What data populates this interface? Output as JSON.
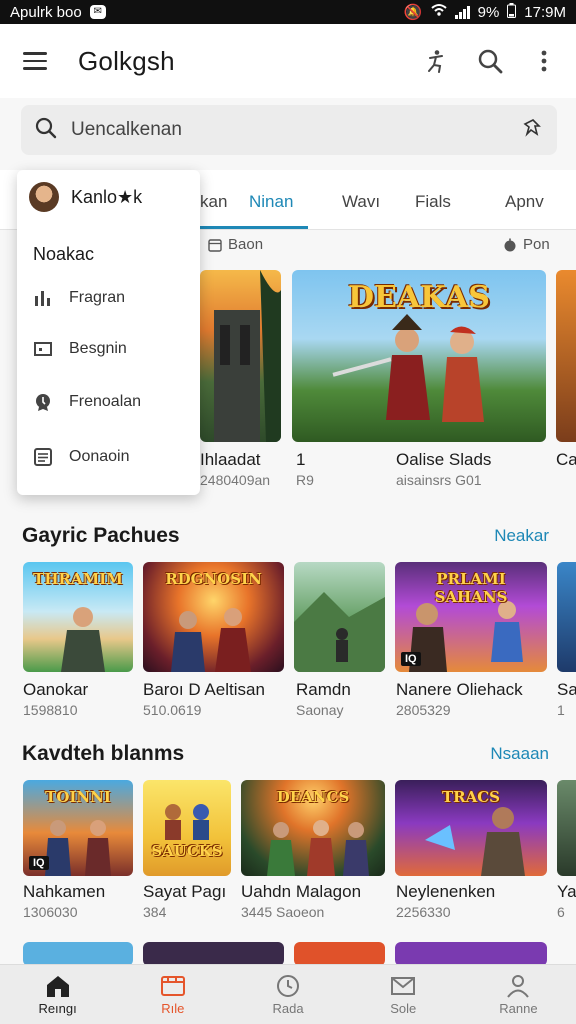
{
  "status_bar": {
    "carrier": "Apulrk boo",
    "battery": "9%",
    "time": "17:9M"
  },
  "app_bar": {
    "title": "Golkgsh",
    "icons": [
      "menu-icon",
      "accessibility-icon",
      "search-icon",
      "more-vert-icon"
    ]
  },
  "search": {
    "placeholder": "Uencalkenan"
  },
  "tabs": [
    {
      "label": "kan"
    },
    {
      "label": "Ninan",
      "active": true
    },
    {
      "label": "Wavı"
    },
    {
      "label": "Fials"
    },
    {
      "label": "Apnv"
    }
  ],
  "filters": {
    "left": "Baon",
    "right": "Pon"
  },
  "dropdown": {
    "user_name": "Kanlo★k",
    "section": "Noakac",
    "items": [
      {
        "label": "Fragran",
        "icon": "chart-icon"
      },
      {
        "label": "Besgnin",
        "icon": "screen-icon"
      },
      {
        "label": "Frenoalan",
        "icon": "badge-icon"
      },
      {
        "label": "Oonaoin",
        "icon": "document-icon"
      }
    ]
  },
  "featured": [
    {
      "title": "Ihlaadat",
      "subtitle": "2480409an"
    },
    {
      "title": "1",
      "subtitle": "R9",
      "art_text": "DEAKAS"
    },
    {
      "title": "Oalise Slads",
      "subtitle": "aisainsrs G01"
    },
    {
      "title": "Ca",
      "subtitle": ""
    }
  ],
  "section1": {
    "title": "Gayric Pachues",
    "more": "Neakar",
    "items": [
      {
        "title": "Oanokar",
        "subtitle": "1598810",
        "art_text": "THRAMIM"
      },
      {
        "title": "Baroı D Aeltisan",
        "subtitle": "510.0619",
        "art_text": "RDGNOSIN"
      },
      {
        "title": "Ramdn",
        "subtitle": "Saonay",
        "art_text": ""
      },
      {
        "title": "Nanere Oliehack",
        "subtitle": "2805329",
        "art_text": "PRLAMI SAHANS"
      },
      {
        "title": "Sa",
        "subtitle": "1"
      }
    ]
  },
  "section2": {
    "title": "Kavdteh blanms",
    "more": "Nsaaan",
    "items": [
      {
        "title": "Nahkamen",
        "subtitle": "1306030",
        "art_text": "TOINNI"
      },
      {
        "title": "Sayat Pagı",
        "subtitle": "384",
        "art_text": "SAUCKS"
      },
      {
        "title": "Uahdn Malagon",
        "subtitle": "3445 Saoeon",
        "art_text": "DEANCS"
      },
      {
        "title": "Neylenenken",
        "subtitle": "2256330",
        "art_text": "TRACS"
      },
      {
        "title": "Ya",
        "subtitle": "6"
      }
    ]
  },
  "bottom_nav": [
    {
      "label": "Reıngı",
      "icon": "home-icon"
    },
    {
      "label": "Rıle",
      "icon": "film-icon",
      "active": true
    },
    {
      "label": "Rada",
      "icon": "clock-icon"
    },
    {
      "label": "Sole",
      "icon": "mail-icon"
    },
    {
      "label": "Ranne",
      "icon": "person-icon"
    }
  ],
  "colors": {
    "accent": "#1e88b6",
    "active_nav": "#e5552b",
    "status_bar": "#101010"
  }
}
